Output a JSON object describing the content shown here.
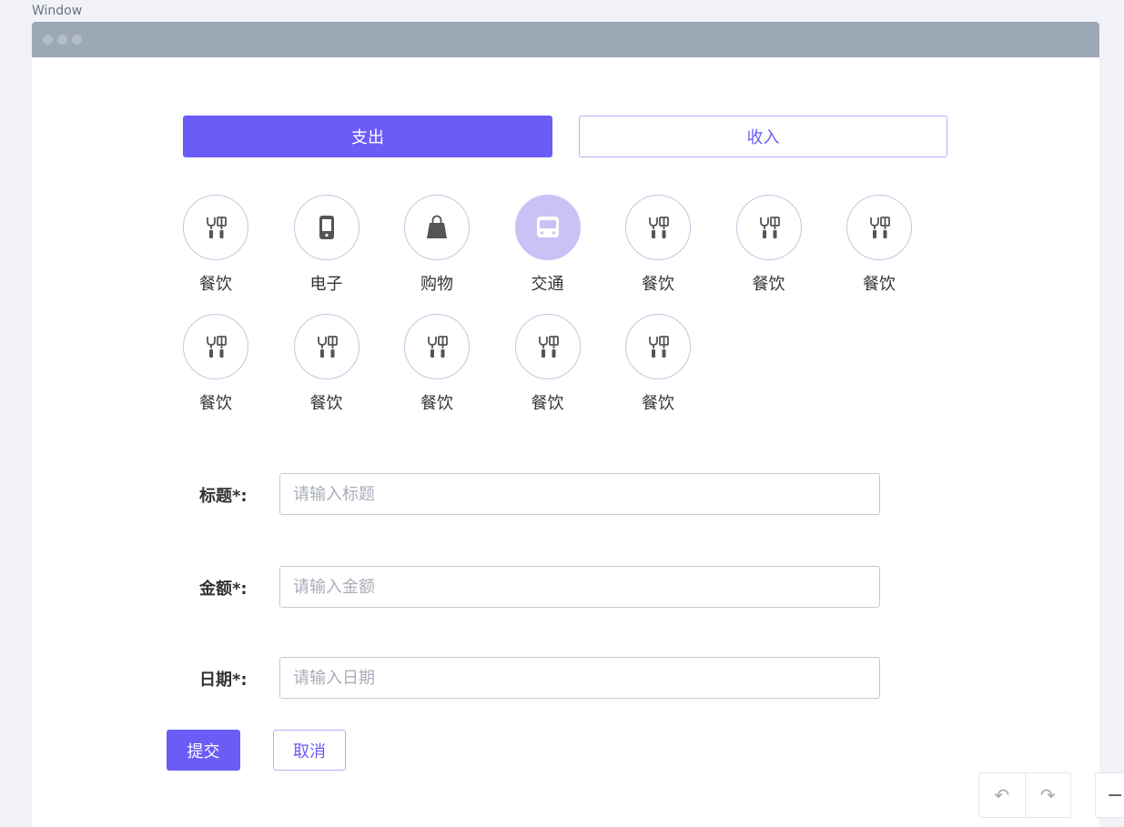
{
  "window": {
    "label": "Window"
  },
  "tabs": {
    "expense": "支出",
    "income": "收入"
  },
  "categories": [
    {
      "label": "餐饮",
      "icon": "utensils-icon"
    },
    {
      "label": "电子",
      "icon": "phone-icon"
    },
    {
      "label": "购物",
      "icon": "shopping-bag-icon"
    },
    {
      "label": "交通",
      "icon": "bus-icon",
      "active": true
    },
    {
      "label": "餐饮",
      "icon": "utensils-icon"
    },
    {
      "label": "餐饮",
      "icon": "utensils-icon"
    },
    {
      "label": "餐饮",
      "icon": "utensils-icon"
    },
    {
      "label": "餐饮",
      "icon": "utensils-icon"
    },
    {
      "label": "餐饮",
      "icon": "utensils-icon"
    },
    {
      "label": "餐饮",
      "icon": "utensils-icon"
    },
    {
      "label": "餐饮",
      "icon": "utensils-icon"
    },
    {
      "label": "餐饮",
      "icon": "utensils-icon"
    }
  ],
  "form": {
    "title_label": "标题*:",
    "title_placeholder": "请输入标题",
    "amount_label": "金额*:",
    "amount_placeholder": "请输入金额",
    "date_label": "日期*:",
    "date_placeholder": "请输入日期"
  },
  "buttons": {
    "submit": "提交",
    "cancel": "取消"
  },
  "toolbar": {
    "undo": "↶",
    "redo": "↷",
    "zoom_out": "−"
  },
  "colors": {
    "primary": "#6b5cf6",
    "active_category": "#c8c2f5",
    "titlebar": "#9ca8b5"
  }
}
